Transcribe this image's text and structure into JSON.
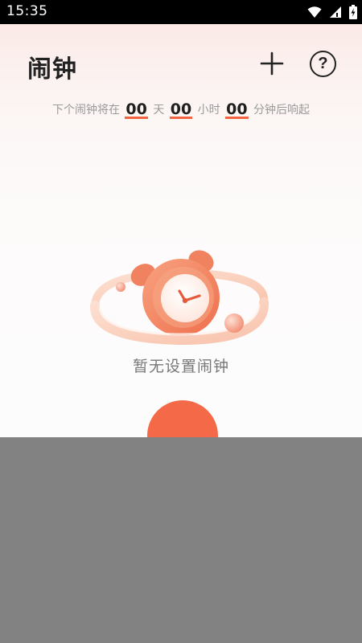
{
  "status_bar": {
    "time": "15:35",
    "icons": [
      "wifi-icon",
      "signal-icon",
      "battery-charging-icon"
    ]
  },
  "header": {
    "title": "闹钟",
    "add_icon": "plus-icon",
    "help_icon": "help-icon",
    "help_glyph": "?"
  },
  "countdown": {
    "prefix": "下个闹钟将在",
    "days": "00",
    "days_unit": "天",
    "hours": "00",
    "hours_unit": "小时",
    "minutes": "00",
    "minutes_unit": "分钟后响起"
  },
  "empty_state": {
    "icon": "alarm-clock-illustration",
    "message": "暂无设置闹钟"
  },
  "fab": {
    "icon": "add-alarm-button"
  },
  "colors": {
    "accent": "#f46a48",
    "underline": "#f2643f",
    "overlay": "#828282"
  }
}
